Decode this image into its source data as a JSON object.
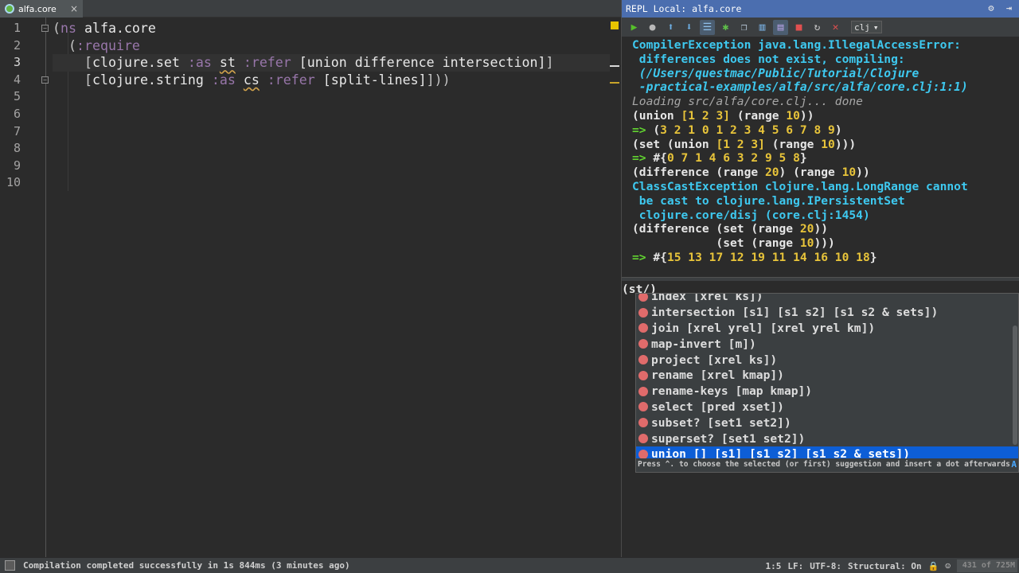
{
  "editor": {
    "tab_title": "alfa.core",
    "tab_close": "×",
    "line_numbers": [
      "1",
      "2",
      "3",
      "4",
      "5",
      "6",
      "7",
      "8",
      "9",
      "10"
    ],
    "current_line": "3",
    "lines": {
      "l1_open": "(",
      "l1_ns": "ns",
      "l1_name": " alfa.core",
      "l2_open": "(",
      "l2_kw": ":require",
      "l3_open": "[",
      "l3_lib": "clojure.set",
      "l3_as": " :as ",
      "l3_alias": "st",
      "l3_refer": " :refer ",
      "l3_vec": "[union difference intersection]",
      "l3_close": "]",
      "l4_open": "[",
      "l4_lib": "clojure.string",
      "l4_as": " :as ",
      "l4_alias": "cs",
      "l4_refer": " :refer ",
      "l4_vec": "[split-lines]",
      "l4_close": "]))"
    }
  },
  "repl": {
    "title": "REPL Local: alfa.core",
    "title_controls": "⚙ ⇥",
    "ns_select": "clj",
    "toolbar_icons": [
      "run-icon",
      "stop-icon",
      "up-icon",
      "down-icon",
      "history-icon",
      "bug-icon",
      "copy-icon",
      "clear-icon",
      "soft-wrap-icon",
      "stop-red-icon",
      "reload-icon",
      "close-icon"
    ],
    "output": {
      "e1": "CompilerException java.lang.IllegalAccessError:",
      "e2": " differences does not exist, compiling:",
      "e3": " (/Users/questmac/Public/Tutorial/Clojure",
      "e4": " -practical-examples/alfa/src/alfa/core.clj:1:1)",
      "loading": "Loading src/alfa/core.clj... done",
      "f1a": "(union ",
      "f1b": "[1 2 3]",
      "f1c": " (range ",
      "f1d": "10",
      "f1e": "))",
      "arrow": "=>",
      "r1a": " (",
      "r1b": "3 2 1 0 1 2 3 4 5 6 7 8 9",
      "r1c": ")",
      "f2a": "(set (union ",
      "f2b": "[1 2 3]",
      "f2c": " (range ",
      "f2d": "10",
      "f2e": ")))",
      "r2a": " #{",
      "r2b": "0 7 1 4 6 3 2 9 5 8",
      "r2c": "}",
      "f3a": "(difference (range ",
      "f3b": "20",
      "f3c": ") (range ",
      "f3d": "10",
      "f3e": "))",
      "c1": "ClassCastException clojure.lang.LongRange cannot",
      "c2": " be cast to clojure.lang.IPersistentSet",
      "c3": " clojure.core/disj (core.clj:1454)",
      "f4a": "(difference (set (range ",
      "f4b": "20",
      "f4c": "))",
      "f5a": "            (set (range ",
      "f5b": "10",
      "f5c": ")))",
      "r3a": " #{",
      "r3b": "15 13 17 12 19 11 14 16 10 18",
      "r3c": "}"
    },
    "input": "(st/)",
    "completions": [
      {
        "name": "index",
        "args": " [xrel ks])"
      },
      {
        "name": "intersection",
        "args": " [s1] [s1 s2] [s1 s2 & sets])"
      },
      {
        "name": "join",
        "args": " [xrel yrel] [xrel yrel km])"
      },
      {
        "name": "map-invert",
        "args": " [m])"
      },
      {
        "name": "project",
        "args": " [xrel ks])"
      },
      {
        "name": "rename",
        "args": " [xrel kmap])"
      },
      {
        "name": "rename-keys",
        "args": " [map kmap])"
      },
      {
        "name": "select",
        "args": " [pred xset])"
      },
      {
        "name": "subset?",
        "args": " [set1 set2])"
      },
      {
        "name": "superset?",
        "args": " [set1 set2])"
      },
      {
        "name": "union",
        "args": " [] [s1] [s1 s2] [s1 s2 & sets])"
      }
    ],
    "selected_completion": "union",
    "completion_hint": "Press ^. to choose the selected (or first) suggestion and insert a dot afterwards",
    "completion_hint_icon": "A"
  },
  "status": {
    "message": "Compilation completed successfully in 1s 844ms (3 minutes ago)",
    "position": "1:5",
    "line_sep": "LF:",
    "encoding": "UTF-8:",
    "structural": "Structural: On",
    "memory": "431 of 725M"
  },
  "colors": {
    "selection": "#0d5ed6",
    "repl_title_bg": "#4b6eaf",
    "error_text": "#3ec9f0",
    "number": "#e8c43a",
    "arrow": "#62d430"
  }
}
